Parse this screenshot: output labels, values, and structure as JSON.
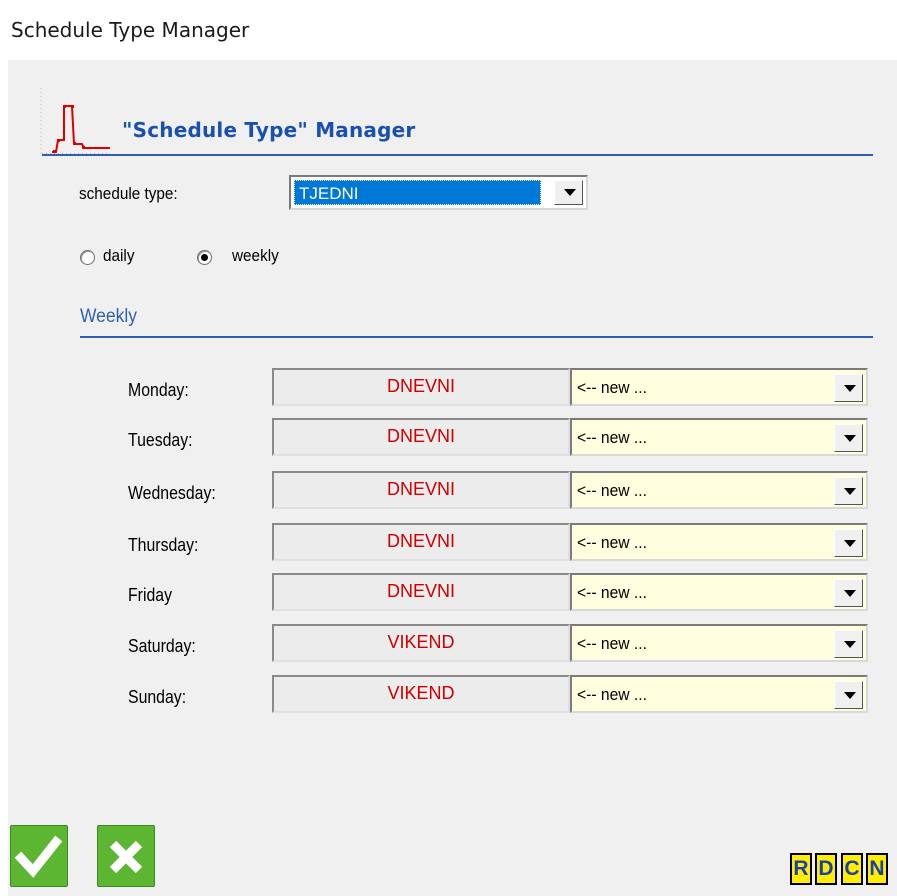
{
  "window": {
    "title": "Schedule Type Manager"
  },
  "header": {
    "title": "\"Schedule Type\" Manager"
  },
  "schedule_type": {
    "label": "schedule type:",
    "value": "TJEDNI"
  },
  "mode": {
    "daily_label": "daily",
    "weekly_label": "weekly",
    "selected": "weekly"
  },
  "weekly": {
    "title": "Weekly",
    "days": [
      {
        "label": "Monday:",
        "value": "DNEVNI",
        "select": "<-- new ..."
      },
      {
        "label": "Tuesday:",
        "value": "DNEVNI",
        "select": "<-- new ..."
      },
      {
        "label": "Wednesday:",
        "value": "DNEVNI",
        "select": "<-- new ..."
      },
      {
        "label": "Thursday:",
        "value": "DNEVNI",
        "select": "<-- new ..."
      },
      {
        "label": "Friday",
        "value": "DNEVNI",
        "select": "<-- new ..."
      },
      {
        "label": "Saturday:",
        "value": "VIKEND",
        "select": "<-- new ..."
      },
      {
        "label": "Sunday:",
        "value": "VIKEND",
        "select": "<-- new ..."
      }
    ]
  },
  "footer": {
    "confirm_icon": "checkmark-icon",
    "cancel_icon": "x-icon",
    "small_buttons": [
      "R",
      "D",
      "C",
      "N"
    ]
  },
  "colors": {
    "accent": "#2e5fb5",
    "value_text": "#d00000",
    "select_bg": "#ffffe0",
    "selection": "#0078d7",
    "ok_green": "#5cb632",
    "letter_button_bg": "#ffee00"
  }
}
